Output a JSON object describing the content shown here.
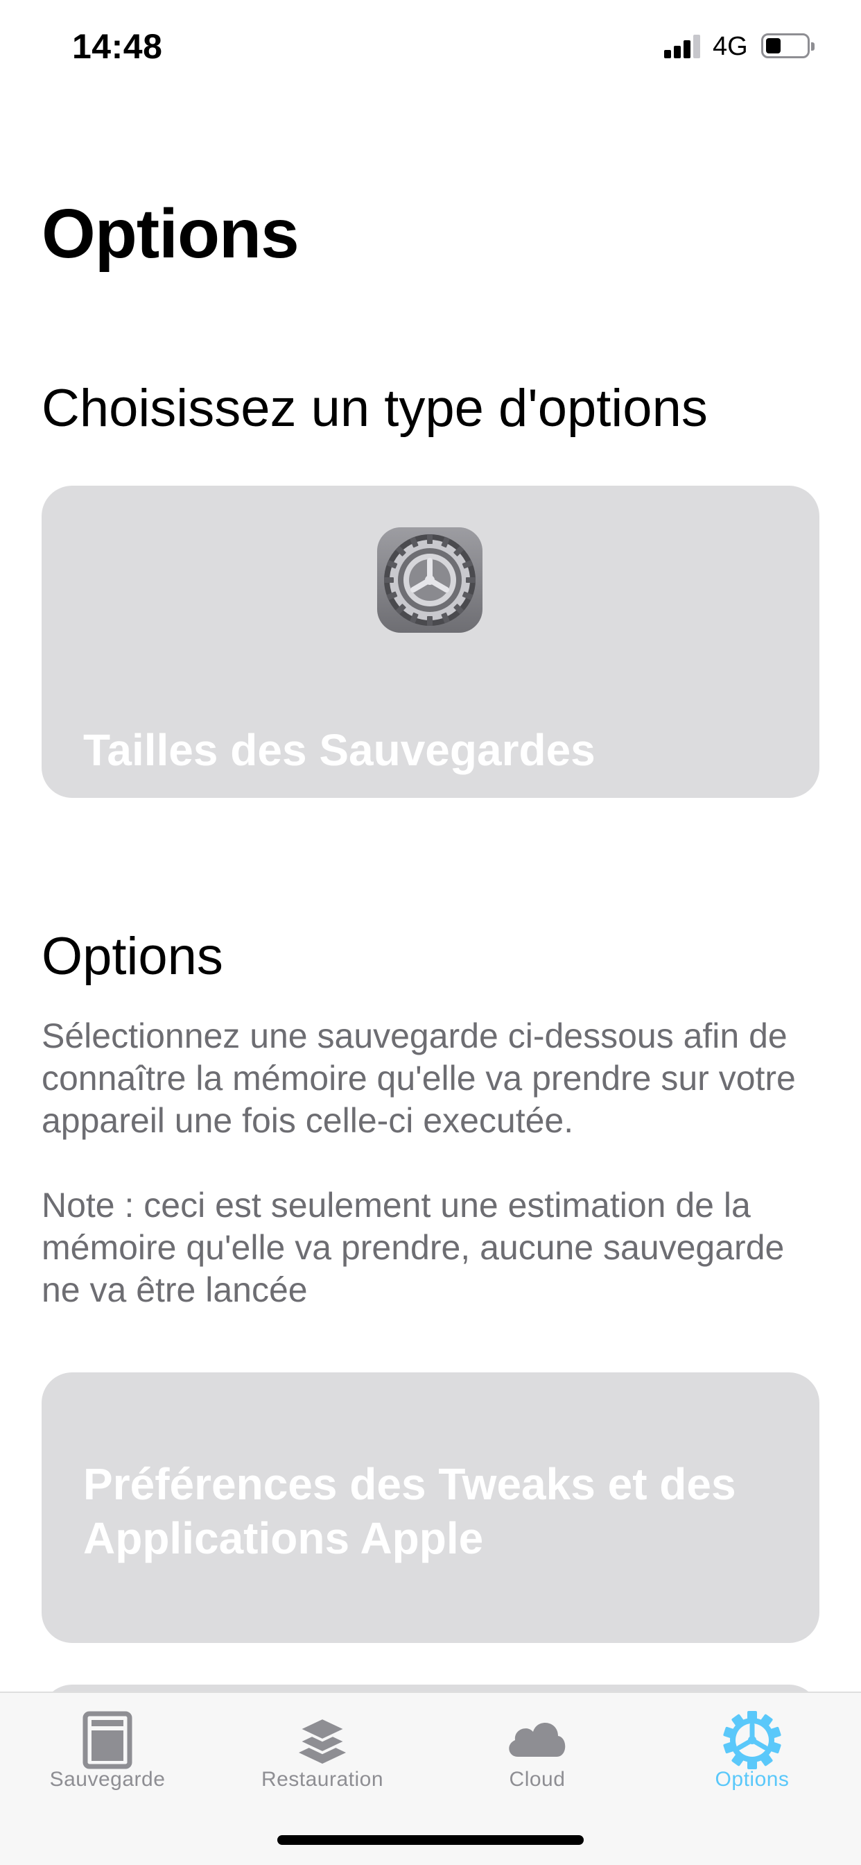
{
  "status_bar": {
    "time": "14:48",
    "network": "4G",
    "signal_bars": 3,
    "signal_bars_total": 4,
    "battery_level": 0.35
  },
  "page": {
    "title": "Options"
  },
  "section_choose": {
    "heading": "Choisissez un type d'options"
  },
  "card_sizes": {
    "icon": "settings-gear-icon",
    "label": "Tailles des Sauvegardes"
  },
  "section_options": {
    "heading": "Options",
    "description": "Sélectionnez une sauvegarde ci-dessous afin de connaître la mémoire qu'elle va prendre sur votre appareil une fois celle-ci executée.",
    "note": "Note : ceci est seulement une estimation de la mémoire qu'elle va prendre, aucune sauvegarde ne va être lancée"
  },
  "card_prefs": {
    "label": "Préférences des Tweaks et des Applications Apple"
  },
  "tabs": [
    {
      "label": "Sauvegarde",
      "icon": "backup-icon",
      "active": false
    },
    {
      "label": "Restauration",
      "icon": "layers-icon",
      "active": false
    },
    {
      "label": "Cloud",
      "icon": "cloud-icon",
      "active": false
    },
    {
      "label": "Options",
      "icon": "gear-icon",
      "active": true
    }
  ],
  "colors": {
    "accent": "#5ac8fa",
    "card_bg": "#dcdcde",
    "tab_inactive": "#8e8e93",
    "secondary_text": "#6d6d72"
  }
}
